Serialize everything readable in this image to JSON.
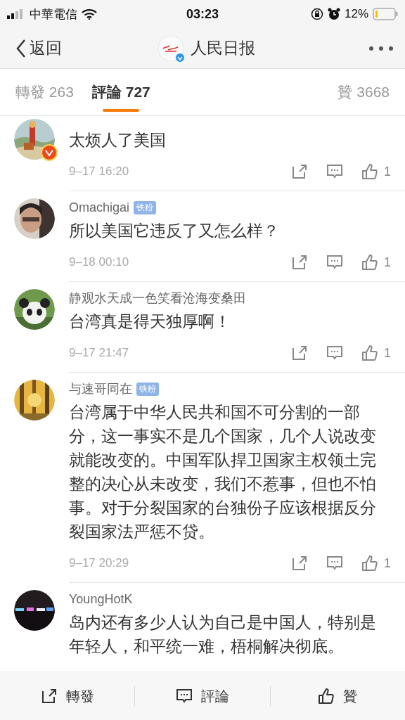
{
  "status_bar": {
    "carrier": "中華電信",
    "time": "03:23",
    "battery": "12%"
  },
  "nav": {
    "back": "返回",
    "title": "人民日报",
    "verified": true
  },
  "tabs": [
    {
      "label": "轉發 263",
      "selected": false
    },
    {
      "label": "評論 727",
      "selected": true
    },
    {
      "label": "贊 3668",
      "selected": false
    }
  ],
  "comments": [
    {
      "verified": true,
      "text": "太烦人了美国",
      "time": "9–17 16:20",
      "likes": "1"
    },
    {
      "name": "Omachigai",
      "badge": "铁粉",
      "verified": false,
      "text": "所以美国它违反了又怎么样？",
      "time": "9–18 00:10",
      "likes": "1"
    },
    {
      "name": "静观水天成一色笑看沧海变桑田",
      "verified": false,
      "text": "台湾真是得天独厚啊！",
      "time": "9–17 21:47",
      "likes": "1"
    },
    {
      "name": "与速哥同在",
      "badge": "铁粉",
      "verified": false,
      "text": "台湾属于中华人民共和国不可分割的一部分，这一事实不是几个国家，几个人说改变就能改变的。中国军队捍卫国家主权领土完整的决心从未改变，我们不惹事，但也不怕事。对于分裂国家的台独份子应该根据反分裂国家法严惩不贷。",
      "time": "9–17 20:29",
      "likes": "1"
    },
    {
      "name": "YoungHotK",
      "verified": false,
      "text": "岛内还有多少人认为自己是中国人，特别是年轻人，和平统一难，梧桐解决彻底。"
    }
  ],
  "bottom_bar": [
    "轉發",
    "評論",
    "贊"
  ]
}
